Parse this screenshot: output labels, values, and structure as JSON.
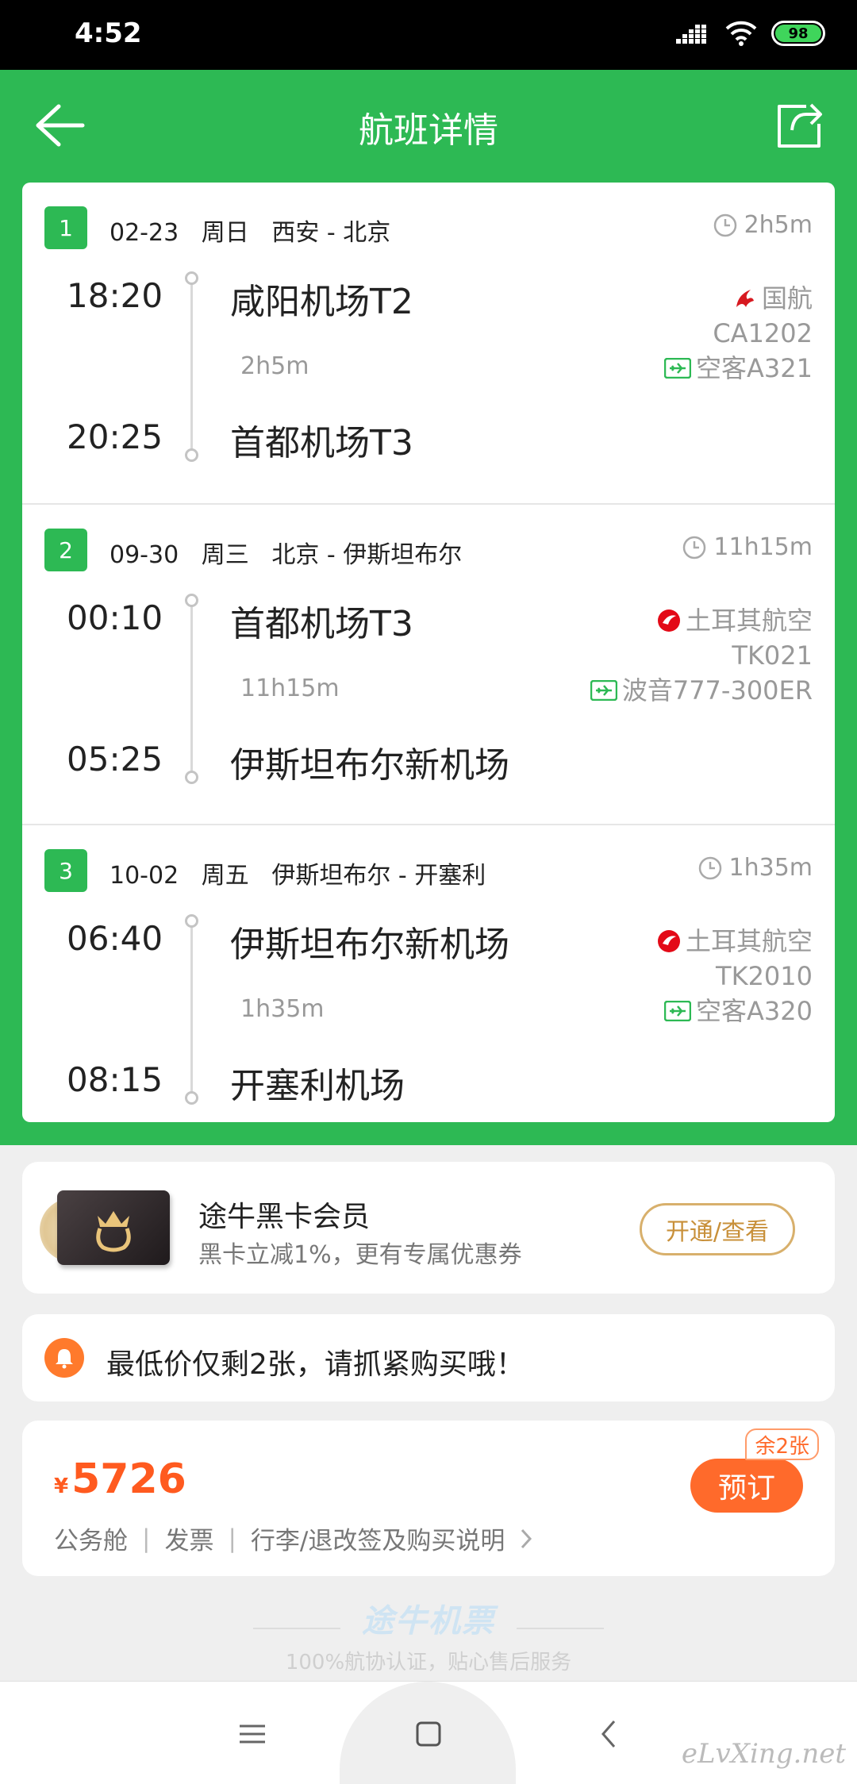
{
  "status_bar": {
    "time": "4:52",
    "battery": "98"
  },
  "header": {
    "title": "航班详情"
  },
  "segments": [
    {
      "index": "1",
      "info": "02-23   周日   西安 - 北京",
      "duration": "2h5m",
      "dep_time": "18:20",
      "dep_airport": "咸阳机场T2",
      "mid_duration": "2h5m",
      "arr_time": "20:25",
      "arr_airport": "首都机场T3",
      "airline": "国航",
      "flight_no": "CA1202",
      "aircraft": "空客A321",
      "logo_color": "#d71920"
    },
    {
      "index": "2",
      "info": "09-30   周三   北京 - 伊斯坦布尔",
      "duration": "11h15m",
      "dep_time": "00:10",
      "dep_airport": "首都机场T3",
      "mid_duration": "11h15m",
      "arr_time": "05:25",
      "arr_airport": "伊斯坦布尔新机场",
      "airline": "土耳其航空",
      "flight_no": "TK021",
      "aircraft": "波音777-300ER",
      "logo_color": "#e30a17"
    },
    {
      "index": "3",
      "info": "10-02   周五   伊斯坦布尔 - 开塞利",
      "duration": "1h35m",
      "dep_time": "06:40",
      "dep_airport": "伊斯坦布尔新机场",
      "mid_duration": "1h35m",
      "arr_time": "08:15",
      "arr_airport": "开塞利机场",
      "airline": "土耳其航空",
      "flight_no": "TK2010",
      "aircraft": "空客A320",
      "logo_color": "#e30a17"
    }
  ],
  "member": {
    "title": "途牛黑卡会员",
    "subtitle": "黑卡立减1%，更有专属优惠券",
    "button": "开通/查看"
  },
  "notice": {
    "text": "最低价仅剩2张，请抓紧购买哦！"
  },
  "price": {
    "currency": "¥",
    "value": "5726",
    "cabin": "公务舱",
    "invoice": "发票",
    "baggage": "行李/退改签及购买说明",
    "book_button": "预订",
    "remaining": "余2张"
  },
  "brand": {
    "name": "途牛机票",
    "subtitle": "100%航协认证，贴心售后服务"
  },
  "watermark": "eLvXing.net",
  "colors": {
    "primary": "#2db954",
    "accent": "#ff6a2b",
    "gold": "#d8b06c"
  }
}
